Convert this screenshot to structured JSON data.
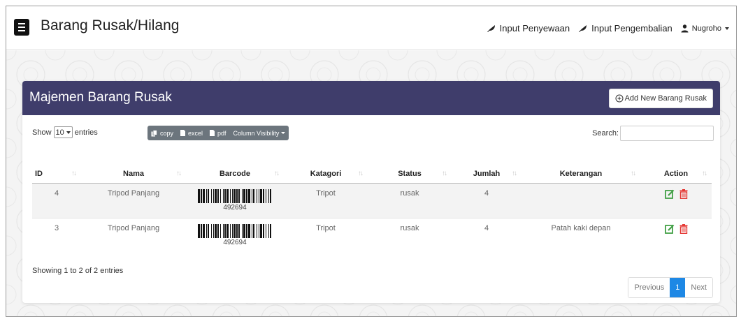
{
  "topbar": {
    "title": "Barang Rusak/Hilang",
    "links": [
      {
        "label": "Input Penyewaan",
        "icon": "leaf-icon"
      },
      {
        "label": "Input Pengembalian",
        "icon": "leaf-icon"
      }
    ],
    "user": {
      "name": "Nugroho",
      "icon": "user-icon"
    }
  },
  "card": {
    "title": "Majemen Barang Rusak",
    "add_button": "Add New Barang Rusak",
    "header_color": "#3f3d6b"
  },
  "controls": {
    "show_label": "Show",
    "length_value": "10",
    "entries_label": "entries",
    "buttons": [
      "copy",
      "excel",
      "pdf",
      "Column Visibility"
    ],
    "search_label": "Search:",
    "search_value": ""
  },
  "table": {
    "columns": [
      "ID",
      "Nama",
      "Barcode",
      "Katagori",
      "Status",
      "Jumlah",
      "Keterangan",
      "Action"
    ],
    "rows": [
      {
        "id": "4",
        "nama": "Tripod Panjang",
        "barcode": "492694",
        "katagori": "Tripot",
        "status": "rusak",
        "jumlah": "4",
        "keterangan": ""
      },
      {
        "id": "3",
        "nama": "Tripod Panjang",
        "barcode": "492694",
        "katagori": "Tripot",
        "status": "rusak",
        "jumlah": "4",
        "keterangan": "Patah kaki depan"
      }
    ]
  },
  "footer": {
    "info": "Showing 1 to 2 of 2 entries",
    "pagination": {
      "previous": "Previous",
      "current": "1",
      "next": "Next"
    }
  },
  "colors": {
    "edit": "#43a047",
    "delete": "#e53935",
    "active_page": "#1e88e5"
  }
}
